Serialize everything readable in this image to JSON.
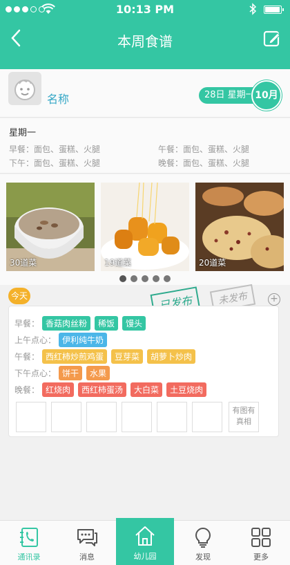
{
  "status": {
    "time": "10:13 PM"
  },
  "header": {
    "title": "本周食谱"
  },
  "profile": {
    "name": "名称",
    "date_text": "28日  星期一",
    "month": "10月"
  },
  "summary": {
    "weekday": "星期一",
    "breakfast": "早餐：面包、蛋糕、火腿",
    "lunch": "午餐：面包、蛋糕、火腿",
    "afternoon": "下午：面包、蛋糕、火腿",
    "dinner": "晚餐：面包、蛋糕、火腿"
  },
  "gallery": [
    {
      "label": "30道菜"
    },
    {
      "label": "19道菜"
    },
    {
      "label": "20道菜"
    }
  ],
  "card": {
    "today": "今天",
    "published": "已发布",
    "unpublished": "未发布",
    "more_images": "有图有真相",
    "rows": [
      {
        "label": "早餐：",
        "tags": [
          "香菇肉丝粉",
          "稀饭",
          "馒头"
        ]
      },
      {
        "label": "上午点心：",
        "tags": [
          "伊利纯牛奶"
        ]
      },
      {
        "label": "午餐：",
        "tags": [
          "西红柿炒煎鸡蛋",
          "豆芽菜",
          "胡萝卜炒肉"
        ]
      },
      {
        "label": "下午点心：",
        "tags": [
          "饼干",
          "水果"
        ]
      },
      {
        "label": "晚餐：",
        "tags": [
          "红烧肉",
          "西红柿蛋汤",
          "大白菜",
          "土豆烧肉"
        ]
      }
    ]
  },
  "tabs": [
    {
      "label": "通讯录",
      "icon": "contacts-icon"
    },
    {
      "label": "消息",
      "icon": "message-icon"
    },
    {
      "label": "幼儿园",
      "icon": "home-icon"
    },
    {
      "label": "发现",
      "icon": "bulb-icon"
    },
    {
      "label": "更多",
      "icon": "grid-icon"
    }
  ],
  "colors": {
    "accent": "#34c6a3"
  }
}
